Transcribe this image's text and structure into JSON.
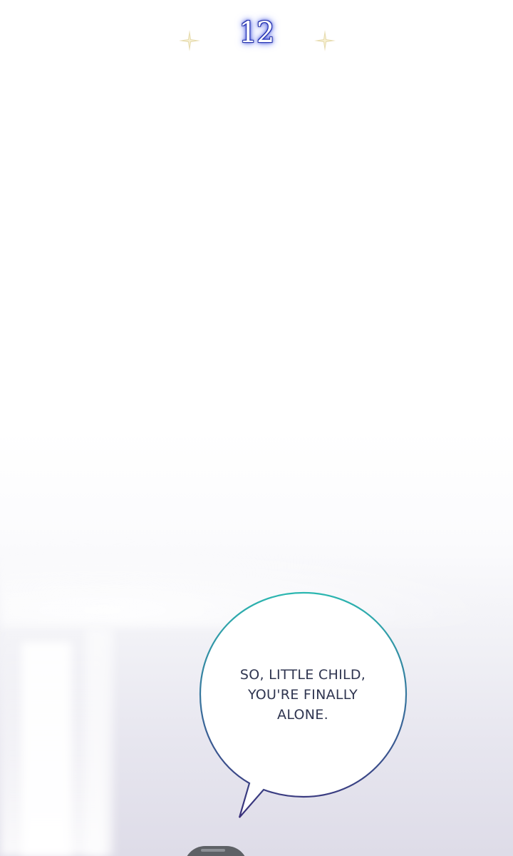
{
  "chapter": {
    "number": "12",
    "glow_color": "#3b4fe0",
    "sparkle_color": "#e7dcb0",
    "sparkle_icon": "four-point-star"
  },
  "speech_bubble": {
    "lines": [
      "SO, LITTLE CHILD,",
      "YOU'RE FINALLY",
      "ALONE."
    ],
    "outline_gradient": [
      "#2bb7b0",
      "#3a2f7a"
    ],
    "text_color": "#2f3550"
  },
  "background": {
    "top_color": "#ffffff",
    "bottom_color": "#dedce8"
  },
  "character": {
    "hair_color": "#5e6166"
  }
}
